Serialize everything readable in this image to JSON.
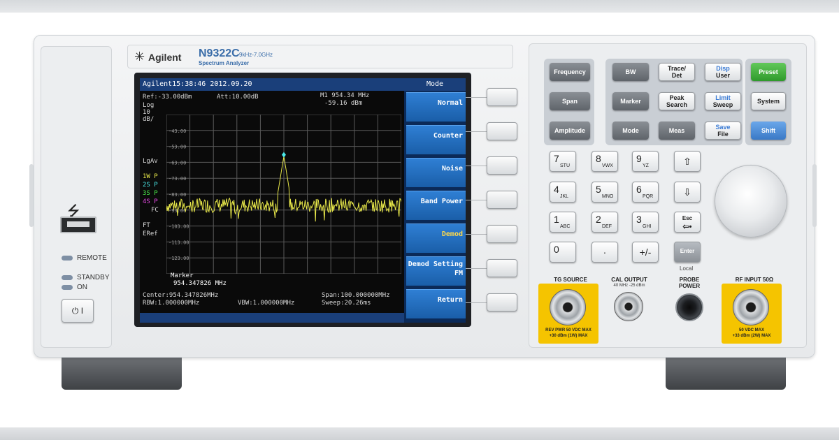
{
  "header": {
    "brand": "Agilent",
    "model": "N9322C",
    "range": "9kHz-7.0GHz",
    "subtitle": "Spectrum Analyzer"
  },
  "left_panel": {
    "usb_icon": "usb-icon",
    "remote_label": "REMOTE",
    "standby_label": "STANDBY",
    "on_label": "ON",
    "power_label": "⏻ I"
  },
  "screen": {
    "status_bar": "Agilent15:38:46 2012.09.20",
    "ref": "Ref:-33.00dBm",
    "att": "Att:10.00dB",
    "marker_line1": "M1 954.34 MHz",
    "marker_line2": "-59.16 dBm",
    "left_labels": [
      "Log",
      "10",
      "dB/",
      "LgAv"
    ],
    "trace_labels": [
      {
        "text": "1W P",
        "color": "#e8e84a"
      },
      {
        "text": "2S P",
        "color": "#4ae8e8"
      },
      {
        "text": "3S P",
        "color": "#4ae84a"
      },
      {
        "text": "4S P",
        "color": "#e84ae8"
      }
    ],
    "fc_label": "FC",
    "ft_label": "FT",
    "eref_label": "ERef",
    "marker_box_title": "Marker",
    "marker_box_value": "954.347826 MHz",
    "center": "Center:954.347826MHz",
    "span": "Span:100.000000MHz",
    "rbw": "RBW:1.000000MHz",
    "vbw": "VBW:1.000000MHz",
    "sweep": "Sweep:20.26ms"
  },
  "chart_data": {
    "type": "line",
    "title": "",
    "xlabel": "",
    "ylabel": "",
    "y_ticks": [
      "-43.00",
      "-53.00",
      "-63.00",
      "-73.00",
      "-83.00",
      "-93.00",
      "-103.00",
      "-113.00",
      "-123.00"
    ],
    "ylim": [
      -133,
      -33
    ],
    "xlim": [
      904.35,
      1004.35
    ],
    "grid": true,
    "trace_color": "#e8e84a",
    "series": [
      {
        "peak_x": 954.34,
        "peak_y": -59.16,
        "noise_floor": -90
      }
    ]
  },
  "softkeys": {
    "title": "Mode",
    "items": [
      {
        "label": "Normal",
        "active": false
      },
      {
        "label": "Counter",
        "active": false
      },
      {
        "label": "Noise",
        "active": false
      },
      {
        "label": "Band Power",
        "active": false
      },
      {
        "label": "Demod",
        "active": true
      },
      {
        "label": "Demod Setting",
        "sub": "FM",
        "active": false
      },
      {
        "label": "Return",
        "active": false
      }
    ]
  },
  "function_keys": {
    "frequency": "Frequency",
    "span": "Span",
    "amplitude": "Amplitude",
    "bw": "BW",
    "trace_det_1": "Trace/",
    "trace_det_2": "Det",
    "disp_user_1": "Disp",
    "disp_user_2": "User",
    "marker": "Marker",
    "peak_search_1": "Peak",
    "peak_search_2": "Search",
    "limit_sweep_1": "Limit",
    "limit_sweep_2": "Sweep",
    "mode": "Mode",
    "meas": "Meas",
    "save_file_1": "Save",
    "save_file_2": "File",
    "preset": "Preset",
    "system": "System",
    "shift": "Shift"
  },
  "keypad": {
    "keys": [
      {
        "digit": "7",
        "letters": "STU"
      },
      {
        "digit": "8",
        "letters": "VWX"
      },
      {
        "digit": "9",
        "letters": "YZ"
      },
      {
        "digit": "4",
        "letters": "JKL"
      },
      {
        "digit": "5",
        "letters": "MNO"
      },
      {
        "digit": "6",
        "letters": "PQR"
      },
      {
        "digit": "1",
        "letters": "ABC"
      },
      {
        "digit": "2",
        "letters": "DEF"
      },
      {
        "digit": "3",
        "letters": "GHI"
      },
      {
        "digit": "0",
        "letters": ""
      },
      {
        "digit": "·",
        "letters": ""
      },
      {
        "digit": "+/-",
        "letters": ""
      }
    ],
    "up": "⇧",
    "down": "⇩",
    "esc_1": "Esc",
    "esc_2": "⇦•",
    "enter": "Enter",
    "local": "Local"
  },
  "ports": {
    "tg_source": "TG SOURCE",
    "tg_warn_1": "REV PWR 50 VDC MAX",
    "tg_warn_2": "+30 dBm (1W) MAX",
    "cal_output": "CAL OUTPUT",
    "cal_sub": "40 MHz -25 dBm",
    "probe_1": "PROBE",
    "probe_2": "POWER",
    "rf_input": "RF INPUT 50Ω",
    "rf_warn_1": "50 VDC MAX",
    "rf_warn_2": "+33 dBm (2W) MAX"
  }
}
